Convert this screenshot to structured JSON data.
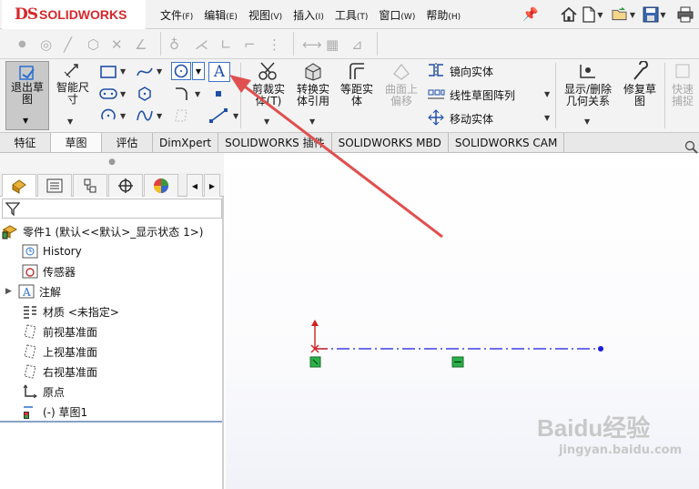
{
  "app": {
    "logo_prefix": "DS",
    "logo_name": "SOLIDWORKS"
  },
  "menu": [
    {
      "label": "文件",
      "key": "(F)"
    },
    {
      "label": "编辑",
      "key": "(E)"
    },
    {
      "label": "视图",
      "key": "(V)"
    },
    {
      "label": "插入",
      "key": "(I)"
    },
    {
      "label": "工具",
      "key": "(T)"
    },
    {
      "label": "窗口",
      "key": "(W)"
    },
    {
      "label": "帮助",
      "key": "(H)"
    }
  ],
  "quick_access": [
    "home-icon",
    "new-document-icon",
    "open-folder-icon",
    "save-icon",
    "print-icon"
  ],
  "command_manager": {
    "exit_sketch": "退出草图",
    "smart_dimension": "智能尺寸",
    "trim": "剪裁实体(T)",
    "convert": "转换实体引用",
    "offset": "等距实体",
    "surface_offset": "曲面上偏移",
    "mirror": "镜向实体",
    "linear_pattern": "线性草图阵列",
    "move": "移动实体",
    "display_relations": "显示/删除几何关系",
    "repair": "修复草图",
    "quick_snaps": "快速捕捉"
  },
  "tabs": [
    {
      "label": "特征",
      "active": false
    },
    {
      "label": "草图",
      "active": true
    },
    {
      "label": "评估",
      "active": false
    },
    {
      "label": "DimXpert",
      "active": false
    },
    {
      "label": "SOLIDWORKS 插件",
      "active": false
    },
    {
      "label": "SOLIDWORKS MBD",
      "active": false
    },
    {
      "label": "SOLIDWORKS CAM",
      "active": false
    }
  ],
  "tree": {
    "root": "零件1  (默认<<默认>_显示状态 1>)",
    "items": [
      "History",
      "传感器",
      "注解",
      "材质 <未指定>",
      "前视基准面",
      "上视基准面",
      "右视基准面",
      "原点",
      "(-) 草图1"
    ]
  },
  "colors": {
    "accent_red": "#d6282b",
    "sketch_blue": "#1a1ae0",
    "arrow_red": "#e05050",
    "relation_green": "#2ab24a"
  },
  "watermark": {
    "brand": "Baidu经验",
    "url": "jingyan.baidu.com"
  }
}
